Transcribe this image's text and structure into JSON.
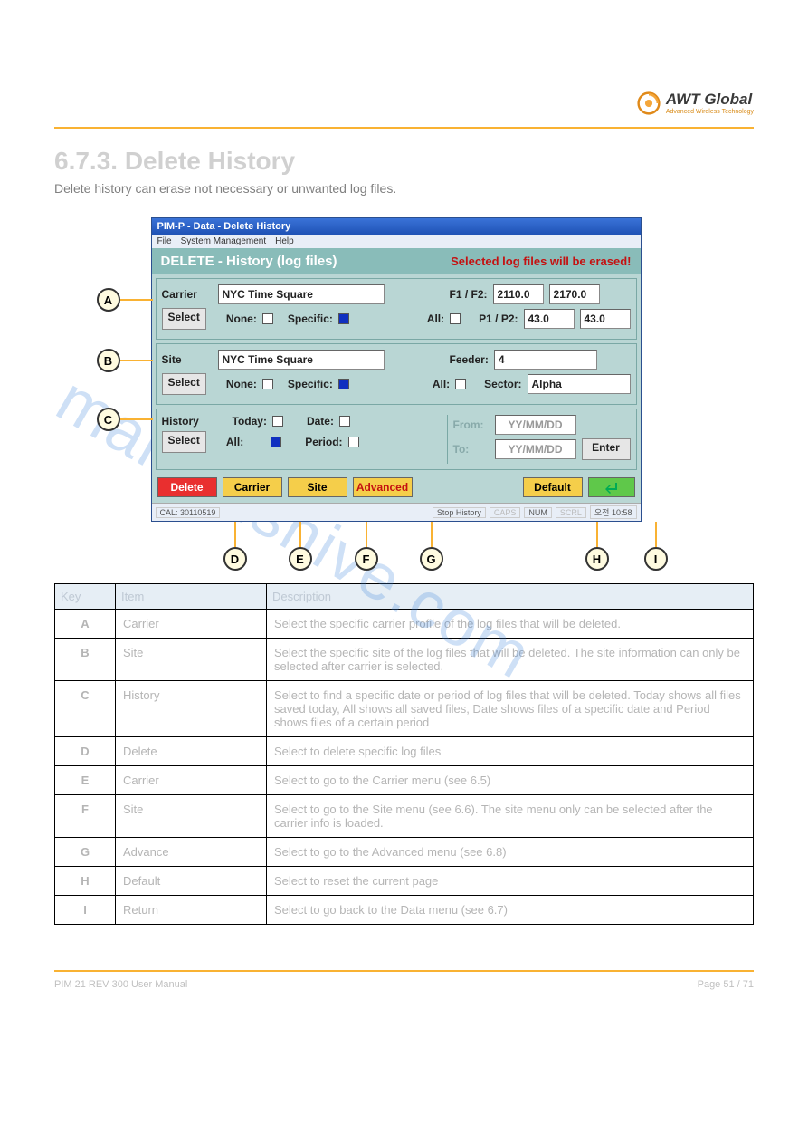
{
  "brand": {
    "name": "AWT Global",
    "subtitle": "Advanced Wireless Technology"
  },
  "section": {
    "title": "6.7.3.  Delete History",
    "text": "Delete history can erase not necessary or unwanted log files."
  },
  "window": {
    "title": "PIM-P - Data - Delete History",
    "menu": [
      "File",
      "System Management",
      "Help"
    ],
    "header_left": "DELETE - History (log files)",
    "header_right": "Selected log files will be erased!",
    "carrier": {
      "label": "Carrier",
      "value": "NYC Time Square",
      "select": "Select",
      "none": "None:",
      "specific": "Specific:",
      "all": "All:",
      "f_label": "F1 / F2:",
      "f1": "2110.0",
      "f2": "2170.0",
      "p_label": "P1 / P2:",
      "p1": "43.0",
      "p2": "43.0"
    },
    "site": {
      "label": "Site",
      "value": "NYC Time Square",
      "select": "Select",
      "none": "None:",
      "specific": "Specific:",
      "all": "All:",
      "feeder_label": "Feeder:",
      "feeder": "4",
      "sector_label": "Sector:",
      "sector": "Alpha"
    },
    "history": {
      "label": "History",
      "select": "Select",
      "today": "Today:",
      "all": "All:",
      "date": "Date:",
      "period": "Period:",
      "from": "From:",
      "to": "To:",
      "placeholder": "YY/MM/DD",
      "enter": "Enter"
    },
    "buttons": {
      "delete": "Delete",
      "carrier": "Carrier",
      "site": "Site",
      "advanced": "Advanced",
      "default": "Default"
    },
    "status": {
      "cal": "CAL: 30110519",
      "mid": "Stop History",
      "caps": "CAPS",
      "num": "NUM",
      "scrl": "SCRL",
      "time": "오전 10:58"
    }
  },
  "callouts": {
    "left": [
      "A",
      "B",
      "C"
    ],
    "bottom": [
      "D",
      "E",
      "F",
      "G",
      "H",
      "I"
    ]
  },
  "table": {
    "headers": [
      "Key",
      "Item",
      "Description"
    ],
    "rows": [
      {
        "k": "A",
        "item": "Carrier",
        "desc": "Select the specific carrier profile of the log files that will be deleted."
      },
      {
        "k": "B",
        "item": "Site",
        "desc": "Select the specific site of the log files that will be deleted. The site information can only be selected after carrier is selected."
      },
      {
        "k": "C",
        "item": "History",
        "desc": "Select to find a specific date or period of log files that will be deleted. Today shows all files saved today, All shows all saved files, Date shows files of a specific date and Period shows files of a certain period"
      },
      {
        "k": "D",
        "item": "Delete",
        "desc": "Select to delete specific log files"
      },
      {
        "k": "E",
        "item": "Carrier",
        "desc": "Select to go to the Carrier menu (see 6.5)"
      },
      {
        "k": "F",
        "item": "Site",
        "desc": "Select to go to the Site menu (see 6.6). The site menu only can be selected after the carrier info is loaded."
      },
      {
        "k": "G",
        "item": "Advance",
        "desc": "Select to go to the Advanced menu (see 6.8)"
      },
      {
        "k": "H",
        "item": "Default",
        "desc": "Select to reset the current page"
      },
      {
        "k": "I",
        "item": "Return",
        "desc": "Select to go back to the Data menu (see 6.7)"
      }
    ]
  },
  "footer": {
    "left": "PIM 21 REV 300 User Manual",
    "right": "Page 51 / 71"
  },
  "watermark": "manualshive.com"
}
